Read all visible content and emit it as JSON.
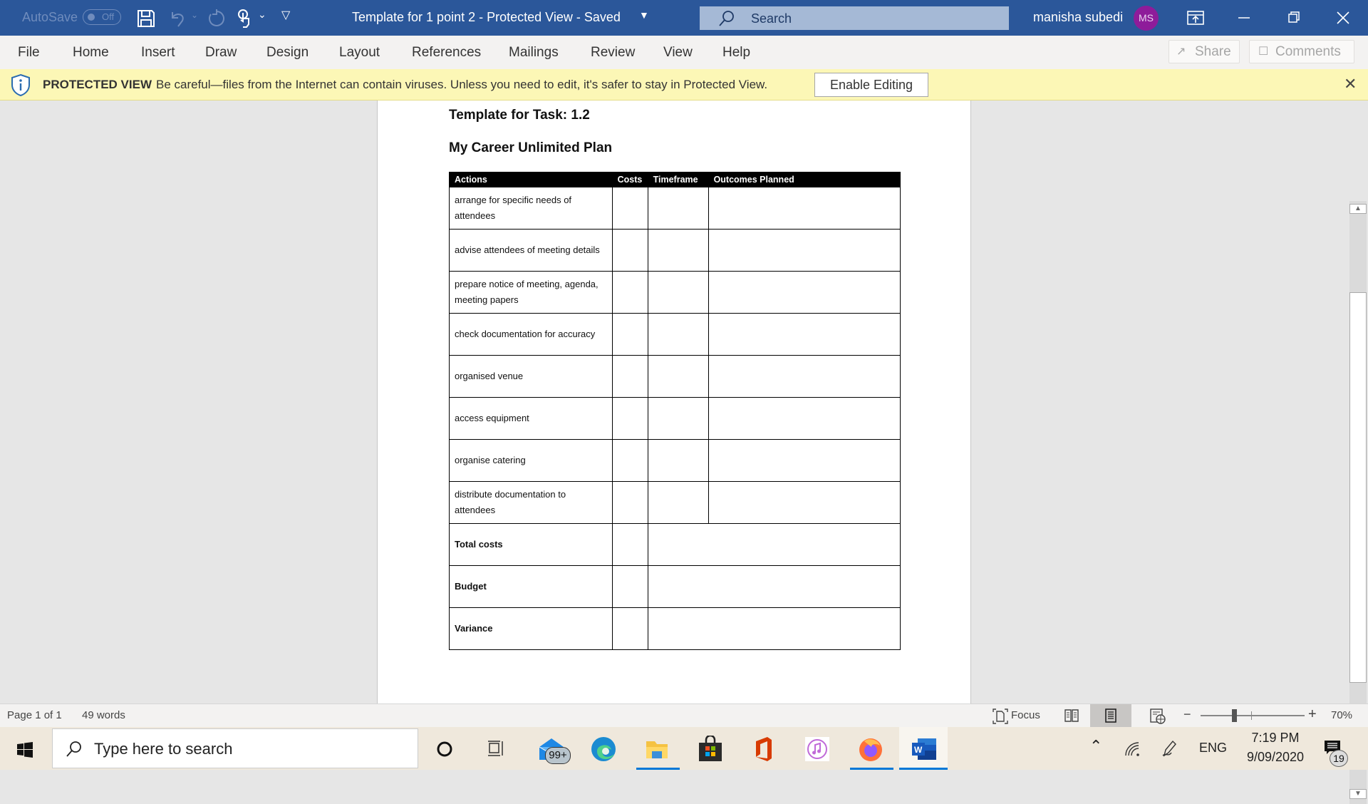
{
  "titlebar": {
    "autosave_label": "AutoSave",
    "autosave_state": "Off",
    "document_title": "Template for 1 point 2  -  Protected View  -  Saved",
    "search_placeholder": "Search",
    "user_name": "manisha subedi",
    "user_initials": "MS",
    "avatar_color": "#8e1c9a",
    "bar_color": "#2b579a"
  },
  "ribbon": {
    "tabs": [
      "File",
      "Home",
      "Insert",
      "Draw",
      "Design",
      "Layout",
      "References",
      "Mailings",
      "Review",
      "View",
      "Help"
    ],
    "share_label": "Share",
    "comments_label": "Comments"
  },
  "protected_view": {
    "title": "PROTECTED VIEW",
    "message": "Be careful—files from the Internet can contain viruses. Unless you need to edit, it's safer to stay in Protected View.",
    "enable_button": "Enable Editing",
    "bar_color": "#fcf7b6"
  },
  "document": {
    "heading": "Template for Task: 1.2",
    "subheading": "My Career Unlimited Plan",
    "table": {
      "headers": [
        "Actions",
        "Costs",
        "Timeframe",
        "Outcomes Planned"
      ],
      "action_rows": [
        [
          "arrange for specific needs of attendees",
          "",
          "",
          ""
        ],
        [
          "advise attendees of meeting details",
          "",
          "",
          ""
        ],
        [
          "prepare notice of meeting, agenda, meeting papers",
          "",
          "",
          ""
        ],
        [
          "check documentation for accuracy",
          "",
          "",
          ""
        ],
        [
          "organised venue",
          "",
          "",
          ""
        ],
        [
          "access equipment",
          "",
          "",
          ""
        ],
        [
          "organise catering",
          "",
          "",
          ""
        ],
        [
          "distribute documentation to attendees",
          "",
          "",
          ""
        ]
      ],
      "summary_rows": [
        [
          "Total costs",
          "",
          ""
        ],
        [
          "Budget",
          "",
          ""
        ],
        [
          "Variance",
          "",
          ""
        ]
      ]
    }
  },
  "statusbar": {
    "page": "Page 1 of 1",
    "words": "49 words",
    "focus_label": "Focus",
    "zoom_level": "70%",
    "zoom_percent": 70
  },
  "taskbar": {
    "search_placeholder": "Type here to search",
    "mail_badge": "99+",
    "time": "7:19 PM",
    "date": "9/09/2020",
    "language": "ENG",
    "notification_count": "19",
    "apps": [
      "mail",
      "edge",
      "file-explorer",
      "microsoft-store",
      "office",
      "itunes",
      "firefox",
      "word"
    ]
  }
}
